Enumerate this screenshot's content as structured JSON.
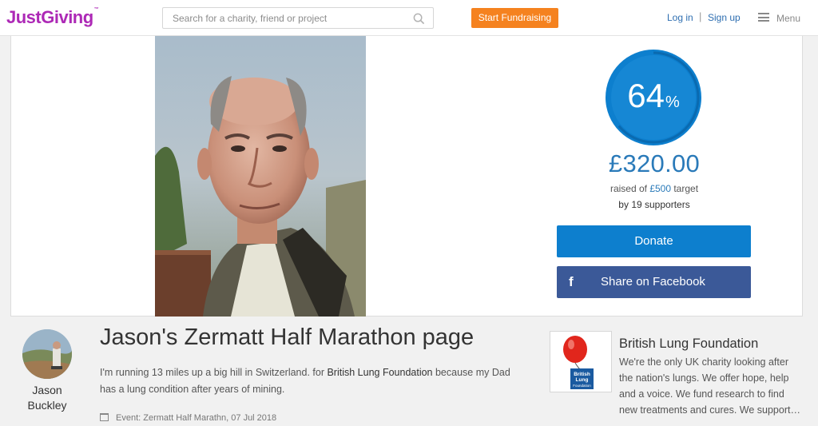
{
  "header": {
    "logo": "JustGiving",
    "logo_tm": "™",
    "search_placeholder": "Search for a charity, friend or project",
    "start_fundraising": "Start Fundraising",
    "login": "Log in",
    "separator": "|",
    "signup": "Sign up",
    "menu": "Menu"
  },
  "progress": {
    "percent_value": "64",
    "percent_sign": "%",
    "fraction": 0.64,
    "raised": "£320.00",
    "raised_prefix": "raised of ",
    "target_amount": "£500",
    "target_suffix": " target",
    "supporters_prefix": "by ",
    "supporters_count": "19",
    "supporters_suffix": " supporters"
  },
  "actions": {
    "donate": "Donate",
    "facebook_icon_glyph": "f",
    "facebook": "Share on Facebook"
  },
  "owner": {
    "first_name": "Jason",
    "last_name": "Buckley"
  },
  "page": {
    "title": "Jason's Zermatt Half Marathon page",
    "story_before": "I'm running 13 miles up a big hill in Switzerland. for ",
    "story_charity": "British Lung Foundation",
    "story_after": " because my Dad has a lung condition after years of mining.",
    "event": "Event: Zermatt Half Marathn, 07 Jul 2018"
  },
  "charity": {
    "name": "British Lung Foundation",
    "logo_text_1": "British",
    "logo_text_2": "Lung",
    "logo_text_3": "Foundation",
    "description": "We're the only UK charity looking after the nation's lungs. We offer hope, help and a voice. We fund research to find new treatments and cures. We support…"
  },
  "colors": {
    "brand": "#ad29b6",
    "accent_orange": "#f5821f",
    "progress_blue": "#0d7fce",
    "facebook_blue": "#3b5998",
    "link_blue": "#2f6fb1"
  }
}
